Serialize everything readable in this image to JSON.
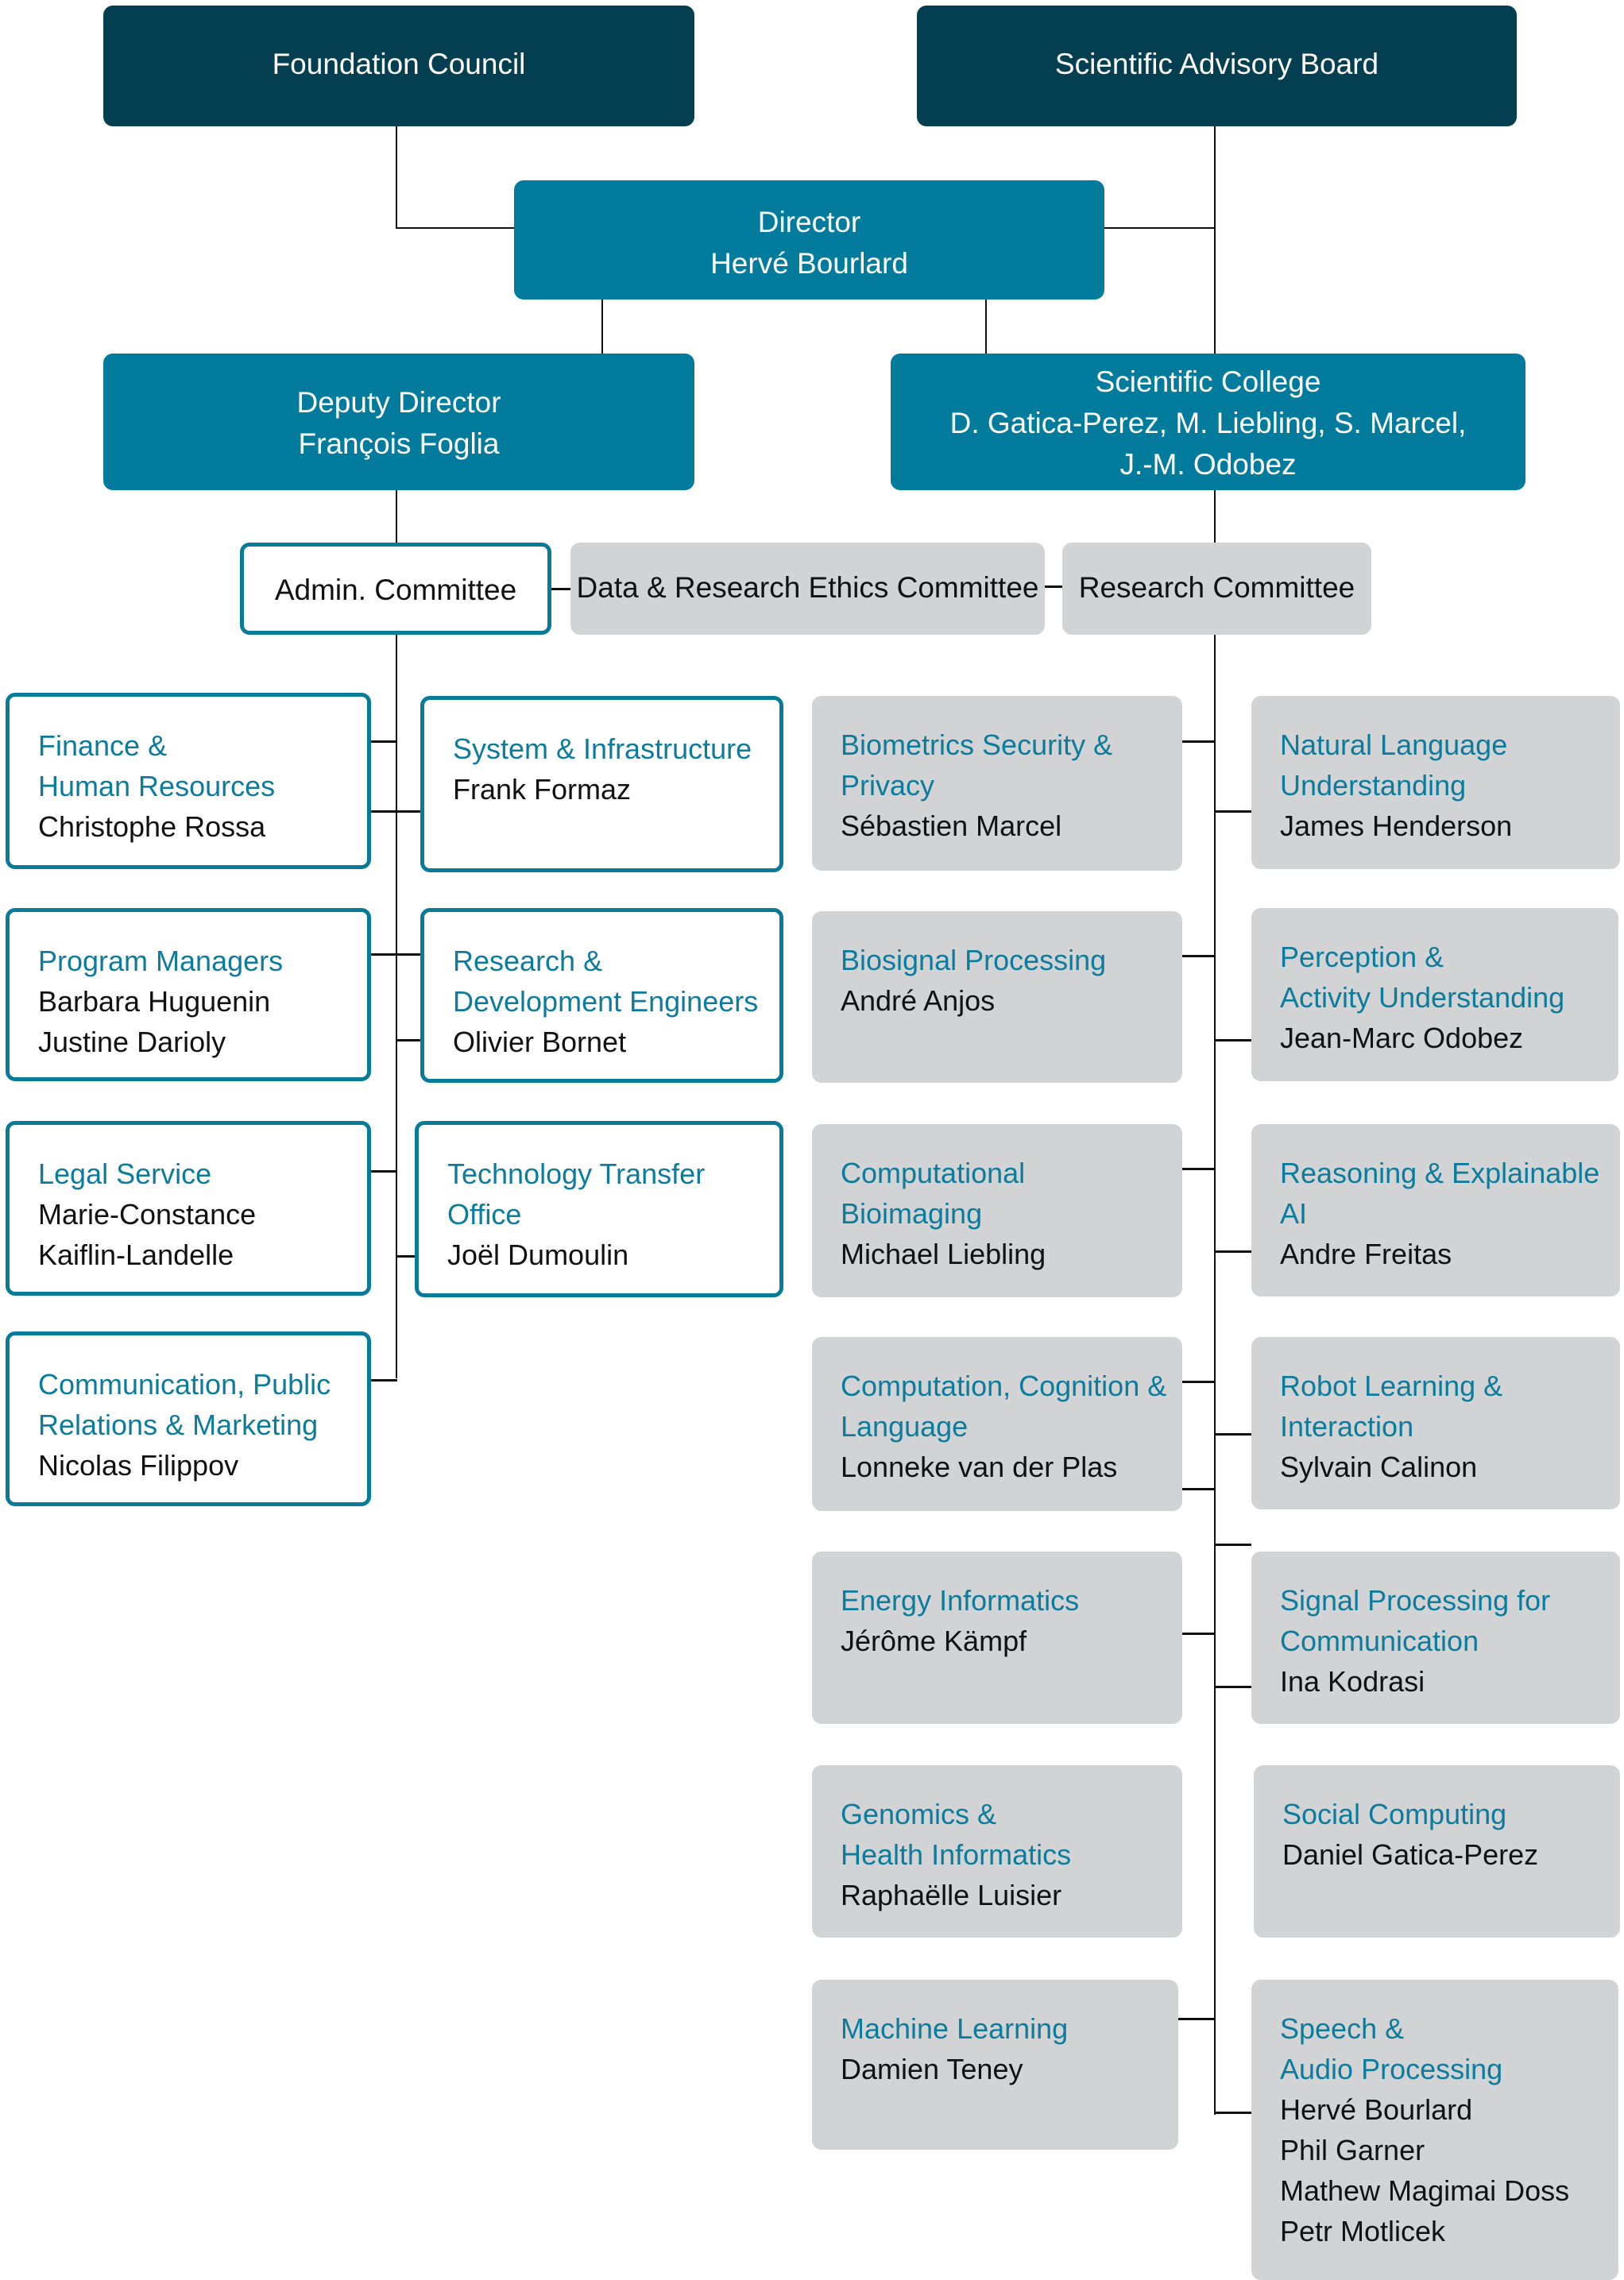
{
  "top": {
    "foundation_council": "Foundation Council",
    "scientific_advisory_board": "Scientific Advisory Board"
  },
  "director": {
    "title": "Director",
    "name": "Hervé Bourlard"
  },
  "deputy_director": {
    "title": "Deputy Director",
    "name": "François Foglia"
  },
  "scientific_college": {
    "title": "Scientific College",
    "members_line1": "D. Gatica-Perez, M. Liebling, S. Marcel,",
    "members_line2": "J.-M. Odobez"
  },
  "committees": {
    "admin": "Admin. Committee",
    "ethics": "Data & Research Ethics Committee",
    "research": "Research Committee"
  },
  "admin_units": [
    {
      "title": [
        "Finance &",
        "Human Resources"
      ],
      "people": [
        "Christophe Rossa"
      ]
    },
    {
      "title": [
        "System & Infrastructure"
      ],
      "people": [
        "Frank Formaz"
      ]
    },
    {
      "title": [
        "Program Managers"
      ],
      "people": [
        "Barbara Huguenin",
        "Justine Darioly"
      ]
    },
    {
      "title": [
        "Research &",
        "Development Engineers"
      ],
      "people": [
        "Olivier Bornet"
      ]
    },
    {
      "title": [
        "Legal Service"
      ],
      "people": [
        "Marie-Constance",
        "Kaiflin-Landelle"
      ]
    },
    {
      "title": [
        "Technology Transfer",
        "Office"
      ],
      "people": [
        "Joël Dumoulin"
      ]
    },
    {
      "title": [
        "Communication, Public",
        "Relations & Marketing"
      ],
      "people": [
        "Nicolas Filippov"
      ]
    }
  ],
  "research_groups": [
    {
      "title": [
        "Biometrics Security &",
        "Privacy"
      ],
      "people": [
        "Sébastien Marcel"
      ]
    },
    {
      "title": [
        "Natural Language",
        "Understanding"
      ],
      "people": [
        "James Henderson"
      ]
    },
    {
      "title": [
        "Biosignal Processing"
      ],
      "people": [
        "André Anjos"
      ]
    },
    {
      "title": [
        "Perception &",
        "Activity Understanding"
      ],
      "people": [
        "Jean-Marc Odobez"
      ]
    },
    {
      "title": [
        "Computational",
        "Bioimaging"
      ],
      "people": [
        "Michael Liebling"
      ]
    },
    {
      "title": [
        "Reasoning & Explainable AI"
      ],
      "people": [
        "Andre Freitas"
      ]
    },
    {
      "title": [
        "Computation, Cognition &",
        "Language"
      ],
      "people": [
        "Lonneke van der Plas"
      ]
    },
    {
      "title": [
        "Robot Learning &",
        "Interaction"
      ],
      "people": [
        "Sylvain Calinon"
      ]
    },
    {
      "title": [
        "Energy Informatics"
      ],
      "people": [
        "Jérôme Kämpf"
      ]
    },
    {
      "title": [
        "Signal Processing for",
        "Communication"
      ],
      "people": [
        "Ina Kodrasi"
      ]
    },
    {
      "title": [
        "Genomics &",
        "Health Informatics"
      ],
      "people": [
        "Raphaëlle Luisier"
      ]
    },
    {
      "title": [
        "Social Computing"
      ],
      "people": [
        "Daniel Gatica-Perez"
      ]
    },
    {
      "title": [
        "Machine Learning"
      ],
      "people": [
        "Damien Teney"
      ]
    },
    {
      "title": [
        "Speech &",
        "Audio Processing"
      ],
      "people": [
        "Hervé Bourlard",
        "Phil Garner",
        "Mathew Magimai Doss",
        "Petr Motlicek"
      ]
    }
  ],
  "colors": {
    "dark_teal": "#043f51",
    "teal": "#027b9d",
    "title_teal": "#0d7c9c",
    "grey_box": "#d2d3d5",
    "connector": "#111111"
  }
}
